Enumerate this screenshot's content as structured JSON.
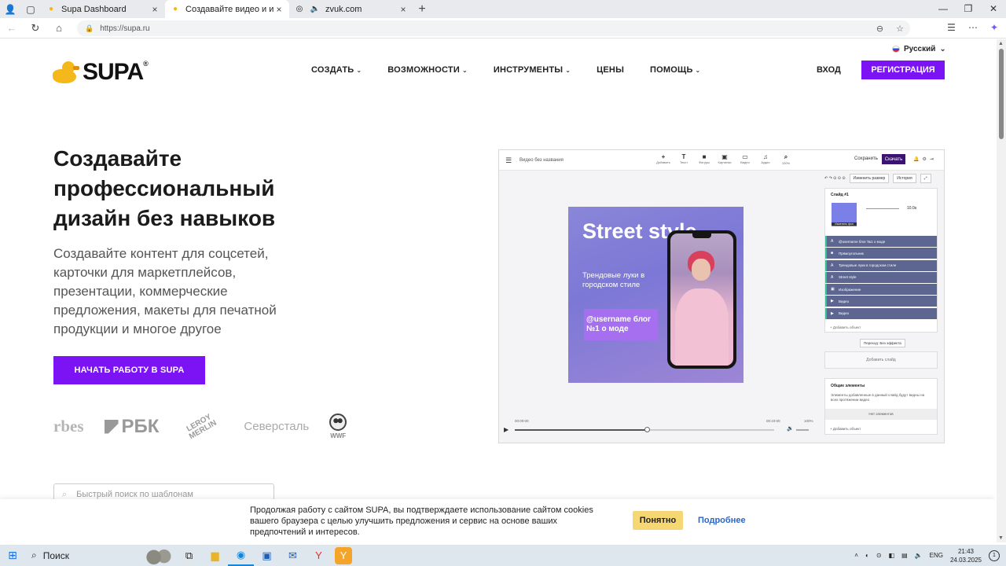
{
  "browser": {
    "tabs": [
      {
        "title": "Supa Dashboard",
        "active": false,
        "favicon": "duck-icon"
      },
      {
        "title": "Создавайте видео и изображения",
        "active": true,
        "favicon": "duck-icon"
      },
      {
        "title": "zvuk.com",
        "active": false,
        "favicon": "zvuk-icon"
      }
    ],
    "url_scheme": "https://",
    "url_host": "supa.ru"
  },
  "site": {
    "language": "Русский",
    "logo_text": "SUPA",
    "logo_mark": "®",
    "nav": [
      {
        "label": "СОЗДАТЬ",
        "dropdown": true
      },
      {
        "label": "ВОЗМОЖНОСТИ",
        "dropdown": true
      },
      {
        "label": "ИНСТРУМЕНТЫ",
        "dropdown": true
      },
      {
        "label": "ЦЕНЫ",
        "dropdown": false
      },
      {
        "label": "ПОМОЩЬ",
        "dropdown": true
      }
    ],
    "login": "ВХОД",
    "register": "РЕГИСТРАЦИЯ",
    "hero": {
      "title": "Создавайте профессиональный дизайн без навыков",
      "subtitle": "Создавайте контент для соцсетей, карточки для маркетплейсов, презентации, коммерческие предложения, макеты для печатной продукции и многое другое",
      "cta": "НАЧАТЬ РАБОТУ В SUPA"
    },
    "partners": {
      "forbes": "rbes",
      "rbc": "РБК",
      "leroy": "LEROY MERLIN",
      "severstal": "Северсталь",
      "wwf": "WWF"
    },
    "search_placeholder": "Быстрый поиск по шаблонам"
  },
  "editor": {
    "project_name": "Видео без названия",
    "tools": [
      {
        "icon": "+",
        "label": "Добавить"
      },
      {
        "icon": "T",
        "label": "Текст"
      },
      {
        "icon": "■",
        "label": "Фигуры"
      },
      {
        "icon": "▣",
        "label": "Картинки"
      },
      {
        "icon": "▭",
        "label": "Видео"
      },
      {
        "icon": "♫",
        "label": "Аудио"
      },
      {
        "icon": "⌕",
        "label": "100%"
      }
    ],
    "save": "Сохранить",
    "download": "Скачать",
    "resize": "Изменить размер",
    "history": "История",
    "canvas": {
      "headline": "Street style",
      "subline": "Трендовые луки в городском стиле",
      "user_text": "@username блог №1 о моде"
    },
    "time_start": "00:00:00",
    "time_end": "00:10:00",
    "volume_pct": "100%",
    "slide_title": "Слайд #1",
    "change_bg": "Изменить фон",
    "duration": "10.0s",
    "layers": [
      {
        "icon": "A",
        "label": "@username блог №1 о моде"
      },
      {
        "icon": "■",
        "label": "Прямоугольник"
      },
      {
        "icon": "A",
        "label": "Трендовые луки в городском стиле"
      },
      {
        "icon": "A",
        "label": "Street style"
      },
      {
        "icon": "▣",
        "label": "Изображение"
      },
      {
        "icon": "▶",
        "label": "Видео"
      },
      {
        "icon": "▶",
        "label": "Видео"
      }
    ],
    "add_object": "+ Добавить объект",
    "transition": "Переход: Без эффекта",
    "add_slide": "Добавить слайд",
    "common_title": "Общие элементы",
    "common_desc": "Элементы добавленные в данный слайд будут видны на всех протяжении видео",
    "no_elements": "Нет элементов",
    "add_object2": "+ Добавить объект"
  },
  "cookie": {
    "text": "Продолжая работу с сайтом SUPA, вы подтверждаете использование сайтом cookies вашего браузера с целью улучшить предложения и сервис на основе ваших предпочтений и интересов.",
    "accept": "Понятно",
    "more": "Подробнее"
  },
  "taskbar": {
    "search_label": "Поиск",
    "lang": "ENG",
    "time": "21:43",
    "date": "24.03.2025",
    "notifications": "1"
  },
  "colors": {
    "accent_purple": "#7b13f5",
    "cookie_button": "#f7d774",
    "link_blue": "#2a66c9"
  }
}
